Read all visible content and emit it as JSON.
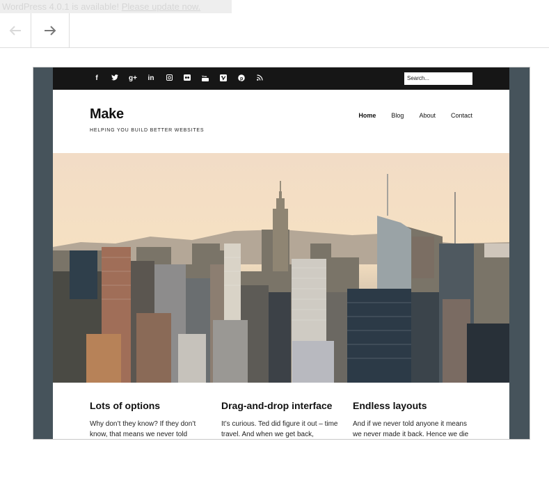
{
  "notice": {
    "text": "WordPress 4.0.1 is available! ",
    "link": "Please update now."
  },
  "nav": {
    "back_icon": "arrow-left-icon",
    "forward_icon": "arrow-right-icon"
  },
  "site": {
    "social_icons": [
      "facebook-icon",
      "twitter-icon",
      "google-plus-icon",
      "linkedin-icon",
      "instagram-icon",
      "flickr-icon",
      "youtube-icon",
      "vimeo-icon",
      "pinterest-icon",
      "rss-icon"
    ],
    "search_placeholder": "Search...",
    "title": "Make",
    "tagline": "HELPING YOU BUILD BETTER WEBSITES",
    "menu": [
      "Home",
      "Blog",
      "About",
      "Contact"
    ],
    "hero_alt": "city skyline",
    "features": [
      {
        "title": "Lots of options",
        "text": "Why don’t they know? If they don’t know, that means we never told"
      },
      {
        "title": "Drag-and-drop interface",
        "text": "It’s curious. Ted did figure it out – time travel. And when we get back,"
      },
      {
        "title": "Endless layouts",
        "text": "And if we never told anyone it means we never made it back. Hence we die"
      }
    ]
  },
  "colors": {
    "frame_bg": "#46535b",
    "topbar_bg": "#161616",
    "notice_text": "#d6d6d6"
  }
}
